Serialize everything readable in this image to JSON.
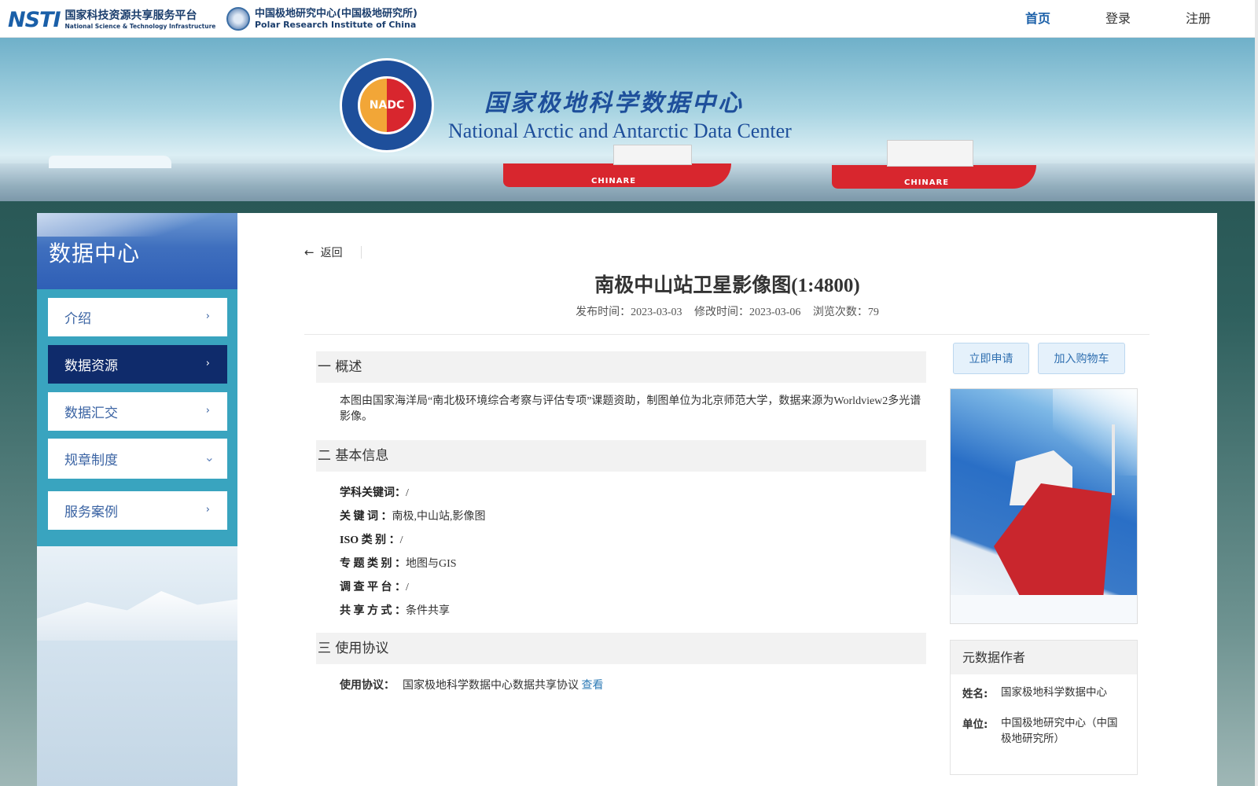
{
  "header": {
    "logo1": {
      "mark": "NSTI",
      "cn": "国家科技资源共享服务平台",
      "en": "National Science & Technology Infrastructure"
    },
    "logo2": {
      "cn": "中国极地研究中心(中国极地研究所)",
      "en": "Polar Research Institute of China"
    },
    "nav": {
      "home": "首页",
      "login": "登录",
      "register": "注册"
    }
  },
  "banner": {
    "seal_text": "NADC",
    "title_cn": "国家极地科学数据中心",
    "title_en": "National Arctic and Antarctic Data Center",
    "ship_label": "CHINARE"
  },
  "sidebar": {
    "title": "数据中心",
    "items": [
      {
        "label": "介绍"
      },
      {
        "label": "数据资源"
      },
      {
        "label": "数据汇交"
      },
      {
        "label": "规章制度"
      },
      {
        "label": "服务案例"
      }
    ]
  },
  "main": {
    "back_label": "返回",
    "title": "南极中山站卫星影像图(1:4800)",
    "meta": {
      "published": "发布时间：2023-03-03",
      "modified": "修改时间：2023-03-06",
      "views": "浏览次数：79"
    },
    "sections": {
      "overview": "一 概述",
      "basic": "二 基本信息",
      "license": "三  使用协议"
    },
    "description": "本图由国家海洋局“南北极环境综合考察与评估专项”课题资助，制图单位为北京师范大学，数据来源为Worldview2多光谱影像。",
    "info": [
      {
        "key": "学科关键词：",
        "value": "/"
      },
      {
        "key": "关  键  词  ：",
        "value": "南极,中山站,影像图"
      },
      {
        "key": "ISO 类 别 ：",
        "value": "/"
      },
      {
        "key": "专 题 类 别 ：",
        "value": "地图与GIS"
      },
      {
        "key": "调 查 平 台 ：",
        "value": "/"
      },
      {
        "key": "共 享 方 式 ：",
        "value": "条件共享"
      }
    ],
    "agreement": {
      "key": "使用协议：",
      "value": "国家极地科学数据中心数据共享协议",
      "link": "查看"
    },
    "buttons": {
      "apply": "立即申请",
      "cart": "加入购物车"
    },
    "author": {
      "heading": "元数据作者",
      "name_key": "姓名:",
      "name": "国家极地科学数据中心",
      "org_key": "单位:",
      "org": "中国极地研究中心（中国极地研究所）"
    }
  }
}
